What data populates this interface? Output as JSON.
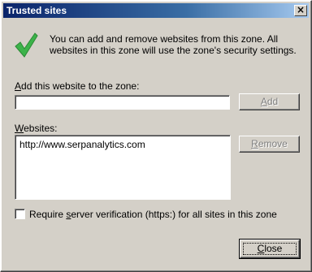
{
  "window": {
    "title": "Trusted sites",
    "close_glyph": "×"
  },
  "info": {
    "icon": "green-checkmark-icon",
    "text": "You can add and remove websites from this zone. All websites in this zone will use the zone's security settings."
  },
  "add_section": {
    "label_accel": "A",
    "label_rest": "dd this website to the zone:",
    "input_value": "",
    "add_button_accel": "A",
    "add_button_rest": "dd"
  },
  "websites_section": {
    "label_accel": "W",
    "label_rest": "ebsites:",
    "items": [
      "http://www.serpanalytics.com"
    ],
    "remove_button_accel": "R",
    "remove_button_rest": "emove"
  },
  "require_https": {
    "checked": false,
    "label_before": "Require ",
    "label_accel": "s",
    "label_after": "erver verification (https:) for all sites in this zone"
  },
  "close_button": {
    "accel": "C",
    "rest": "lose"
  },
  "colors": {
    "dialog_bg": "#d4d0c8",
    "title_start": "#0a246a",
    "check_green": "#3cb34a"
  }
}
